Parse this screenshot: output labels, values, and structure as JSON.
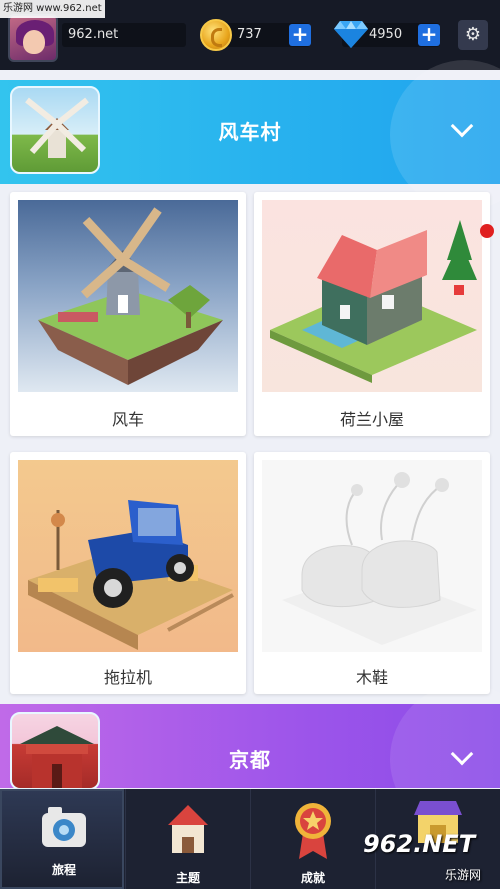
{
  "watermark_top": "乐游网 www.962.net",
  "topbar": {
    "username": "962.net",
    "coins": "737",
    "gems": "4950",
    "coin_plus": "+",
    "gem_plus": "+",
    "settings_icon": "⚙"
  },
  "sections": [
    {
      "title": "风车村",
      "cards": [
        {
          "label": "风车"
        },
        {
          "label": "荷兰小屋"
        },
        {
          "label": "拖拉机"
        },
        {
          "label": "木鞋"
        }
      ]
    },
    {
      "title": "京都"
    }
  ],
  "bottom_nav": [
    {
      "label": "旅程",
      "active": true
    },
    {
      "label": "主题"
    },
    {
      "label": "成就"
    },
    {
      "label": ""
    }
  ],
  "watermark_bottom": {
    "main": "962.NET",
    "sub": "乐游网"
  },
  "colors": {
    "windmill_header": "#27b0ee",
    "kyoto_header": "#9d55ea",
    "plus_button": "#1f6fe0",
    "notification_dot": "#e02020"
  }
}
